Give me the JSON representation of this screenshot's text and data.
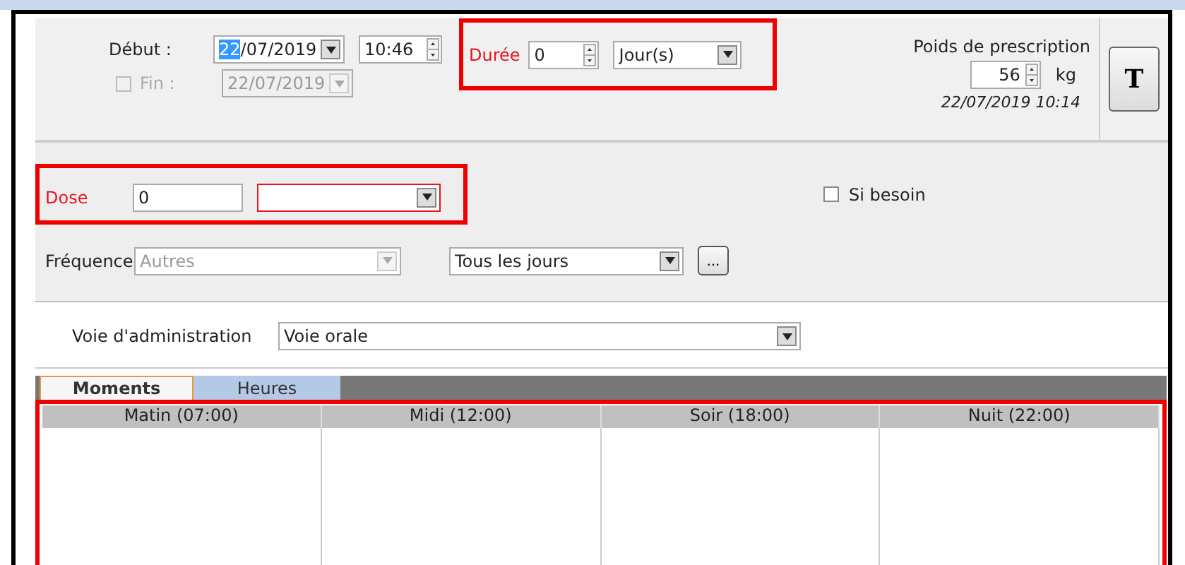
{
  "start": {
    "label": "Début  :",
    "date_selected": "22",
    "date_rest": "/07/2019",
    "time": "10:46"
  },
  "end": {
    "label": "Fin :",
    "checked": false,
    "disabled": true,
    "date": "22/07/2019"
  },
  "duration": {
    "label": "Durée",
    "value": "0",
    "unit": "Jour(s)",
    "highlighted": true
  },
  "weight": {
    "label": "Poids de prescription",
    "value": "56",
    "unit": "kg",
    "timestamp": "22/07/2019 10:14"
  },
  "t_button": "T",
  "dose": {
    "label": "Dose",
    "value": "0",
    "highlighted": true
  },
  "as_needed": {
    "label": "Si besoin",
    "checked": false
  },
  "frequency": {
    "label": "Fréquence",
    "value": "Autres",
    "disabled": true,
    "schedule": "Tous les jours",
    "more_button": "..."
  },
  "route": {
    "label": "Voie d'administration",
    "value": "Voie orale"
  },
  "tabs": [
    {
      "label": "Moments",
      "selected": true
    },
    {
      "label": "Heures",
      "selected": false
    }
  ],
  "grid": {
    "highlighted": true,
    "columns": [
      "Matin (07:00)",
      "Midi (12:00)",
      "Soir (18:00)",
      "Nuit (22:00)"
    ]
  }
}
